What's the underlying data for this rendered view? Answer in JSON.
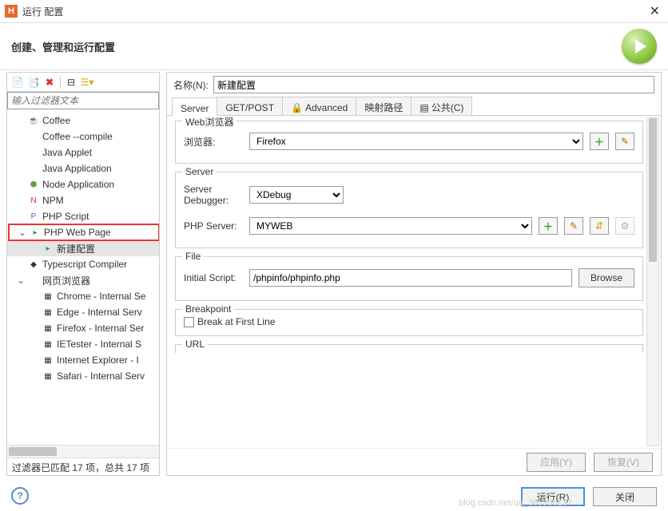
{
  "window": {
    "title": "运行 配置",
    "subtitle": "创建、管理和运行配置"
  },
  "filter": {
    "placeholder": "输入过滤器文本"
  },
  "tree": {
    "items": [
      {
        "label": "Coffee",
        "icon": "☕"
      },
      {
        "label": "Coffee --compile",
        "icon": ""
      },
      {
        "label": "Java Applet",
        "icon": ""
      },
      {
        "label": "Java Application",
        "icon": ""
      },
      {
        "label": "Node Application",
        "icon": "⬢",
        "iconColor": "#6b9b3a"
      },
      {
        "label": "NPM",
        "icon": "N",
        "iconColor": "#c33"
      },
      {
        "label": "PHP Script",
        "icon": "P",
        "iconColor": "#3a6ebf"
      },
      {
        "label": "PHP Web Page",
        "icon": "▸",
        "boxed": true,
        "expanded": true,
        "iconColor": "#3a9e3a"
      },
      {
        "label": "新建配置",
        "child": true,
        "selected": true,
        "icon": "▸",
        "iconColor": "#3a9e3a"
      },
      {
        "label": "Typescript Compiler",
        "icon": "◆",
        "iconColor": "#333"
      },
      {
        "label": "网页浏览器",
        "icon": "",
        "expanded": true
      },
      {
        "label": "Chrome - Internal Se",
        "child": true,
        "icon": "▦"
      },
      {
        "label": "Edge - Internal Serv",
        "child": true,
        "icon": "▦"
      },
      {
        "label": "Firefox - Internal Ser",
        "child": true,
        "icon": "▦"
      },
      {
        "label": "IETester - Internal S",
        "child": true,
        "icon": "▦"
      },
      {
        "label": "Internet Explorer - I",
        "child": true,
        "icon": "▦"
      },
      {
        "label": "Safari - Internal Serv",
        "child": true,
        "icon": "▦"
      }
    ],
    "footer": "过滤器已匹配 17 项，总共 17 项"
  },
  "name": {
    "label": "名称(N):",
    "value": "新建配置"
  },
  "tabs": [
    "Server",
    "GET/POST",
    "Advanced",
    "映射路径",
    "公共(C)"
  ],
  "server": {
    "group_web": "Web浏览器",
    "browser_label": "浏览器:",
    "browser_value": "Firefox",
    "group_server": "Server",
    "debugger_label": "Server Debugger:",
    "debugger_value": "XDebug",
    "phpserver_label": "PHP Server:",
    "phpserver_value": "MYWEB",
    "group_file": "File",
    "initial_label": "Initial Script:",
    "initial_value": "/phpinfo/phpinfo.php",
    "browse": "Browse",
    "group_bp": "Breakpoint",
    "bp_check": "Break at First Line",
    "group_url": "URL"
  },
  "btns": {
    "apply": "应用(Y)",
    "revert": "恢复(V)",
    "run": "运行(R)",
    "close": "关闭"
  },
  "watermark": "blog.csdn.net/qq_365950137"
}
